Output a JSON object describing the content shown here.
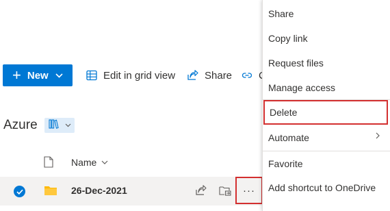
{
  "command_bar": {
    "new_label": "New",
    "edit_grid_label": "Edit in grid view",
    "share_label": "Share",
    "copy_link_label_partial": "C"
  },
  "library": {
    "title": "Azure"
  },
  "list": {
    "column_name": "Name",
    "rows": [
      {
        "name": "26-Dec-2021",
        "type": "folder",
        "selected": true
      }
    ]
  },
  "context_menu": {
    "items": [
      {
        "label": "Share"
      },
      {
        "label": "Copy link"
      },
      {
        "label": "Request files"
      },
      {
        "label": "Manage access"
      },
      {
        "label": "Delete",
        "highlighted": true
      },
      {
        "label": "Automate",
        "has_submenu": true
      },
      {
        "label": "Favorite"
      },
      {
        "label": "Add shortcut to OneDrive"
      }
    ]
  },
  "colors": {
    "accent": "#0078d4",
    "highlight_border": "#d32f2f",
    "folder": "#ffb900",
    "selected_row": "#f3f2f1"
  }
}
